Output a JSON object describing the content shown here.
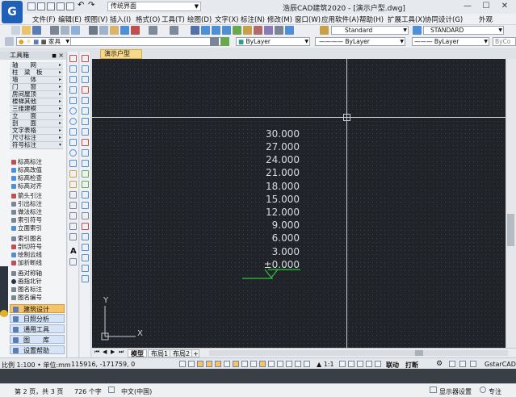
{
  "window": {
    "title": "浩辰CAD建筑2020 - [演示户型.dwg]",
    "workspace": "传统界面",
    "controls": [
      "—",
      "☐",
      "✕"
    ]
  },
  "menu": [
    "文件(F)",
    "编辑(E)",
    "视图(V)",
    "插入(I)",
    "格式(O)",
    "工具(T)",
    "绘图(D)",
    "文字(X)",
    "标注(N)",
    "修改(M)",
    "窗口(W)",
    "应用软件(A)",
    "帮助(H)",
    "扩展工具(X)",
    "协同设计(G)",
    "外观"
  ],
  "toolbar": {
    "layer_name": "家具",
    "color": "ByLayer",
    "linetype": "ByLayer",
    "lineweight": "ByLayer",
    "text_style": "Standard",
    "dim_style": "STANDARD",
    "plot_style": "ByCo"
  },
  "toolbox": {
    "title": "工具箱",
    "categories": [
      "轴　　网",
      "柱　梁　板",
      "墙　　体",
      "门　　窗",
      "房间屋顶",
      "楼梯其他",
      "三维建模",
      "立　　面",
      "剖　　面",
      "文字表格",
      "尺寸标注",
      "符号标注"
    ],
    "tools": [
      "标高标注",
      "标高改值",
      "标高检查",
      "标高对齐",
      "箭头引注",
      "引出标注",
      "做法标注",
      "索引符号",
      "立面索引",
      "索引图名",
      "剖切符号",
      "绘制云线",
      "加折断线",
      "画对称轴",
      "画指北针",
      "图名标注",
      "图名编号"
    ],
    "bottom_tabs": [
      "建筑设计",
      "日照分析",
      "通用工具",
      "图　　库",
      "设置帮助"
    ]
  },
  "document": {
    "tab": "演示户型",
    "elevations": [
      "30.000",
      "27.000",
      "24.000",
      "21.000",
      "18.000",
      "15.000",
      "12.000",
      "9.000",
      "6.000",
      "3.000",
      "±0.000"
    ],
    "ucs_x": "X",
    "ucs_y": "Y"
  },
  "layout_tabs": [
    "模型",
    "布局1",
    "布局2"
  ],
  "status": {
    "scale_units": "比例 1:100 • 单位:mm",
    "coords": "115916, -171759, 0",
    "anno_scale": "1:1",
    "linkage": "联动",
    "print": "打断",
    "brand": "GstarCAD"
  },
  "doc_status": {
    "page": "第 2 页，共 3 页",
    "words": "726 个字",
    "language": "中文(中国)",
    "display_settings": "显示器设置",
    "focus": "专注"
  },
  "colors": {
    "canvas": "#202328",
    "green_mark": "#2fbf3f",
    "accent": "#1f5fb8"
  }
}
